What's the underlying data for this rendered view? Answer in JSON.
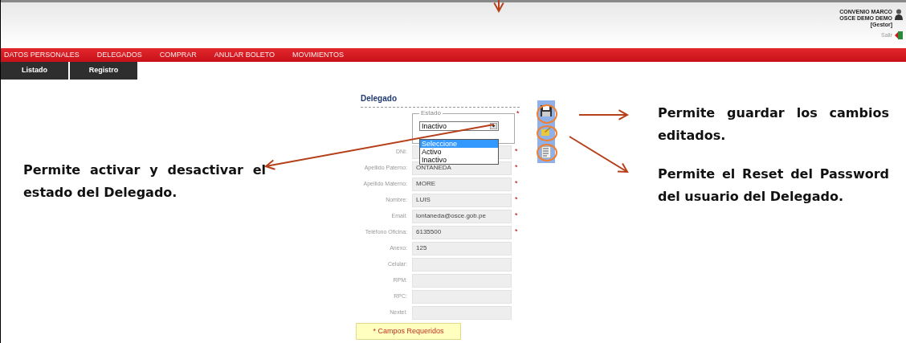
{
  "header": {
    "user_lines": [
      "CONVENIO MARCO",
      "OSCE DEMO DEMO",
      "[Gestor]"
    ],
    "logout": "Salir"
  },
  "nav": [
    {
      "label": "DATOS PERSONALES"
    },
    {
      "label": "DELEGADOS"
    },
    {
      "label": "COMPRAR"
    },
    {
      "label": "ANULAR BOLETO"
    },
    {
      "label": "MOVIMIENTOS"
    }
  ],
  "subtabs": [
    {
      "label": "Listado"
    },
    {
      "label": "Registro"
    }
  ],
  "form": {
    "title": "Delegado",
    "estado": {
      "legend": "Estado",
      "value": "Inactivo",
      "required_mark": "*",
      "options": [
        {
          "label": "Seleccione",
          "highlighted": true
        },
        {
          "label": "Activo",
          "highlighted": false
        },
        {
          "label": "Inactivo",
          "highlighted": false
        }
      ]
    },
    "fields": [
      {
        "label": "DNI:",
        "required_mark": "*"
      },
      {
        "label": "Apellido Paterno:",
        "value": "ONTANEDA",
        "required_mark": "*"
      },
      {
        "label": "Apellido Materno:",
        "value": "MORE",
        "required_mark": "*"
      },
      {
        "label": "Nombre:",
        "value": "LUIS",
        "required_mark": "*"
      },
      {
        "label": "Email:",
        "value": "lontaneda@osce.gob.pe",
        "required_mark": "*"
      },
      {
        "label": "Teléfono Oficina:",
        "value": "6135500",
        "required_mark": "*"
      },
      {
        "label": "Anexo:",
        "value": "125"
      },
      {
        "label": "Celular:"
      },
      {
        "label": "RPM:"
      },
      {
        "label": "RPC:"
      },
      {
        "label": "Nextel:"
      }
    ],
    "note": "* Campos Requeridos"
  },
  "annotations": [
    {
      "text": "Permite activar y desactivar el estado del Delegado."
    },
    {
      "text": "Permite guardar los cambios editados."
    },
    {
      "text": "Permite el Reset del Password del usuario del Delegado."
    }
  ]
}
